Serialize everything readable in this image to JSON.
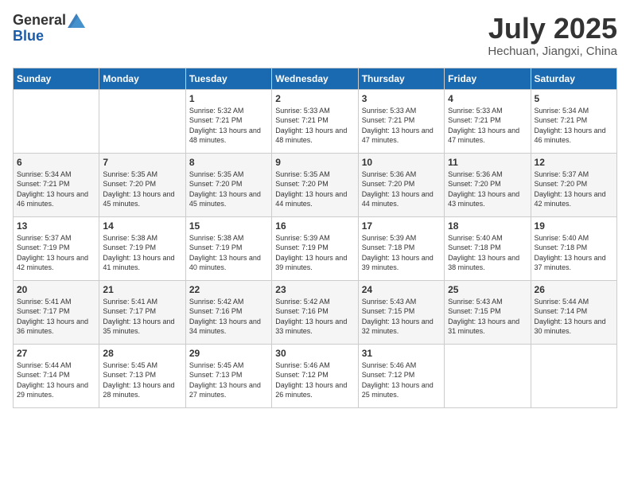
{
  "header": {
    "logo_general": "General",
    "logo_blue": "Blue",
    "month": "July 2025",
    "location": "Hechuan, Jiangxi, China"
  },
  "days_of_week": [
    "Sunday",
    "Monday",
    "Tuesday",
    "Wednesday",
    "Thursday",
    "Friday",
    "Saturday"
  ],
  "weeks": [
    [
      {
        "day": "",
        "info": ""
      },
      {
        "day": "",
        "info": ""
      },
      {
        "day": "1",
        "info": "Sunrise: 5:32 AM\nSunset: 7:21 PM\nDaylight: 13 hours and 48 minutes."
      },
      {
        "day": "2",
        "info": "Sunrise: 5:33 AM\nSunset: 7:21 PM\nDaylight: 13 hours and 48 minutes."
      },
      {
        "day": "3",
        "info": "Sunrise: 5:33 AM\nSunset: 7:21 PM\nDaylight: 13 hours and 47 minutes."
      },
      {
        "day": "4",
        "info": "Sunrise: 5:33 AM\nSunset: 7:21 PM\nDaylight: 13 hours and 47 minutes."
      },
      {
        "day": "5",
        "info": "Sunrise: 5:34 AM\nSunset: 7:21 PM\nDaylight: 13 hours and 46 minutes."
      }
    ],
    [
      {
        "day": "6",
        "info": "Sunrise: 5:34 AM\nSunset: 7:21 PM\nDaylight: 13 hours and 46 minutes."
      },
      {
        "day": "7",
        "info": "Sunrise: 5:35 AM\nSunset: 7:20 PM\nDaylight: 13 hours and 45 minutes."
      },
      {
        "day": "8",
        "info": "Sunrise: 5:35 AM\nSunset: 7:20 PM\nDaylight: 13 hours and 45 minutes."
      },
      {
        "day": "9",
        "info": "Sunrise: 5:35 AM\nSunset: 7:20 PM\nDaylight: 13 hours and 44 minutes."
      },
      {
        "day": "10",
        "info": "Sunrise: 5:36 AM\nSunset: 7:20 PM\nDaylight: 13 hours and 44 minutes."
      },
      {
        "day": "11",
        "info": "Sunrise: 5:36 AM\nSunset: 7:20 PM\nDaylight: 13 hours and 43 minutes."
      },
      {
        "day": "12",
        "info": "Sunrise: 5:37 AM\nSunset: 7:20 PM\nDaylight: 13 hours and 42 minutes."
      }
    ],
    [
      {
        "day": "13",
        "info": "Sunrise: 5:37 AM\nSunset: 7:19 PM\nDaylight: 13 hours and 42 minutes."
      },
      {
        "day": "14",
        "info": "Sunrise: 5:38 AM\nSunset: 7:19 PM\nDaylight: 13 hours and 41 minutes."
      },
      {
        "day": "15",
        "info": "Sunrise: 5:38 AM\nSunset: 7:19 PM\nDaylight: 13 hours and 40 minutes."
      },
      {
        "day": "16",
        "info": "Sunrise: 5:39 AM\nSunset: 7:19 PM\nDaylight: 13 hours and 39 minutes."
      },
      {
        "day": "17",
        "info": "Sunrise: 5:39 AM\nSunset: 7:18 PM\nDaylight: 13 hours and 39 minutes."
      },
      {
        "day": "18",
        "info": "Sunrise: 5:40 AM\nSunset: 7:18 PM\nDaylight: 13 hours and 38 minutes."
      },
      {
        "day": "19",
        "info": "Sunrise: 5:40 AM\nSunset: 7:18 PM\nDaylight: 13 hours and 37 minutes."
      }
    ],
    [
      {
        "day": "20",
        "info": "Sunrise: 5:41 AM\nSunset: 7:17 PM\nDaylight: 13 hours and 36 minutes."
      },
      {
        "day": "21",
        "info": "Sunrise: 5:41 AM\nSunset: 7:17 PM\nDaylight: 13 hours and 35 minutes."
      },
      {
        "day": "22",
        "info": "Sunrise: 5:42 AM\nSunset: 7:16 PM\nDaylight: 13 hours and 34 minutes."
      },
      {
        "day": "23",
        "info": "Sunrise: 5:42 AM\nSunset: 7:16 PM\nDaylight: 13 hours and 33 minutes."
      },
      {
        "day": "24",
        "info": "Sunrise: 5:43 AM\nSunset: 7:15 PM\nDaylight: 13 hours and 32 minutes."
      },
      {
        "day": "25",
        "info": "Sunrise: 5:43 AM\nSunset: 7:15 PM\nDaylight: 13 hours and 31 minutes."
      },
      {
        "day": "26",
        "info": "Sunrise: 5:44 AM\nSunset: 7:14 PM\nDaylight: 13 hours and 30 minutes."
      }
    ],
    [
      {
        "day": "27",
        "info": "Sunrise: 5:44 AM\nSunset: 7:14 PM\nDaylight: 13 hours and 29 minutes."
      },
      {
        "day": "28",
        "info": "Sunrise: 5:45 AM\nSunset: 7:13 PM\nDaylight: 13 hours and 28 minutes."
      },
      {
        "day": "29",
        "info": "Sunrise: 5:45 AM\nSunset: 7:13 PM\nDaylight: 13 hours and 27 minutes."
      },
      {
        "day": "30",
        "info": "Sunrise: 5:46 AM\nSunset: 7:12 PM\nDaylight: 13 hours and 26 minutes."
      },
      {
        "day": "31",
        "info": "Sunrise: 5:46 AM\nSunset: 7:12 PM\nDaylight: 13 hours and 25 minutes."
      },
      {
        "day": "",
        "info": ""
      },
      {
        "day": "",
        "info": ""
      }
    ]
  ]
}
